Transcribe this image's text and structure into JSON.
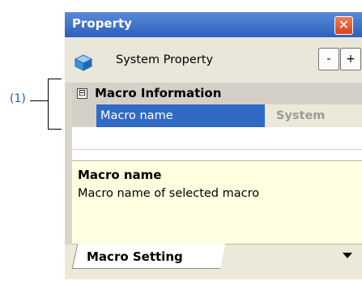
{
  "callout": {
    "label": "(1)"
  },
  "panel": {
    "title": "Property",
    "close_label": "✕",
    "toolbar": {
      "title": "System Property",
      "minus_label": "-",
      "plus_label": "+"
    },
    "grid": {
      "category": {
        "expander": "⊟",
        "label": "Macro Information"
      },
      "rows": [
        {
          "name": "Macro name",
          "value": "System"
        }
      ]
    },
    "description": {
      "title": "Macro name",
      "text": "Macro name of selected macro"
    },
    "tabs": [
      {
        "label": "Macro Setting"
      }
    ],
    "icons": {
      "toolbar": "cube-icon",
      "dropdown": "dropdown-arrow-icon"
    }
  }
}
